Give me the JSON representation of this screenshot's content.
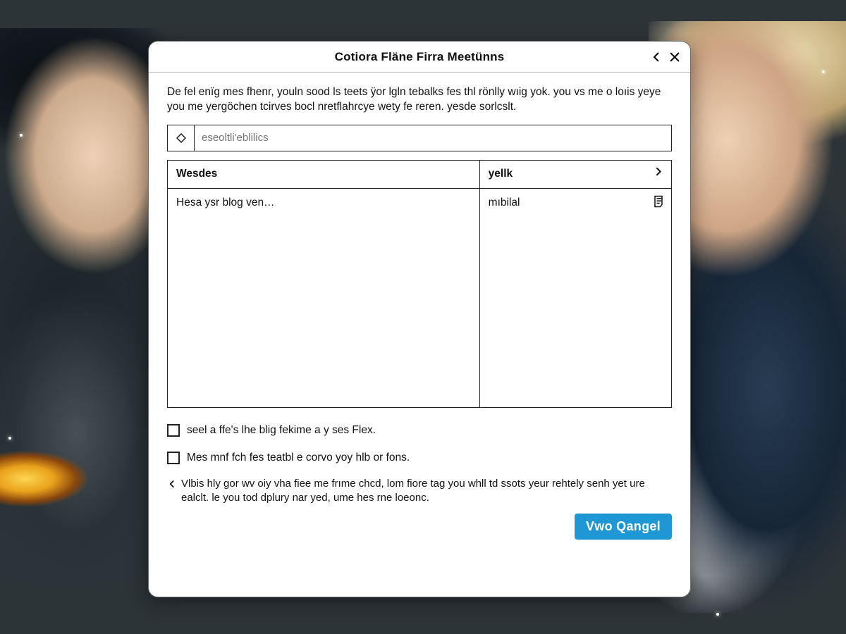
{
  "dialog": {
    "title": "Cotiora Fläne Firra Meetünns",
    "intro": "De fel enïg mes fhenr, youln sood ls teets ÿor lgln tebalks fes thl rönlly wıig yok. you vs me o loıis yeye you me yergöchen tcirves bocl nretflahrcye wety fe reren. yesde sorlcslt.",
    "search_placeholder": "eseoltli'eblilics",
    "columns": {
      "a": "Wesdes",
      "b": "yellk"
    },
    "row": {
      "a": "Hesa ysr blog ven…",
      "b": "mıbilal"
    },
    "checkbox1_label": "seel a ffe's lhe blig fekime a y ses Flex.",
    "checkbox2_label": "Mes mnf fch fes teatbl e corvo yoy hlb or fons.",
    "footnote": "Vlbis hly gor wv oiy vha fiee me frıme chcd, lom fiore tag you whll td ssots yeur rehtely senh yet ure ealclt. le you tod dplury nar yed, ume hes rne loeonc.",
    "primary_button": "Vwo Qangel"
  }
}
